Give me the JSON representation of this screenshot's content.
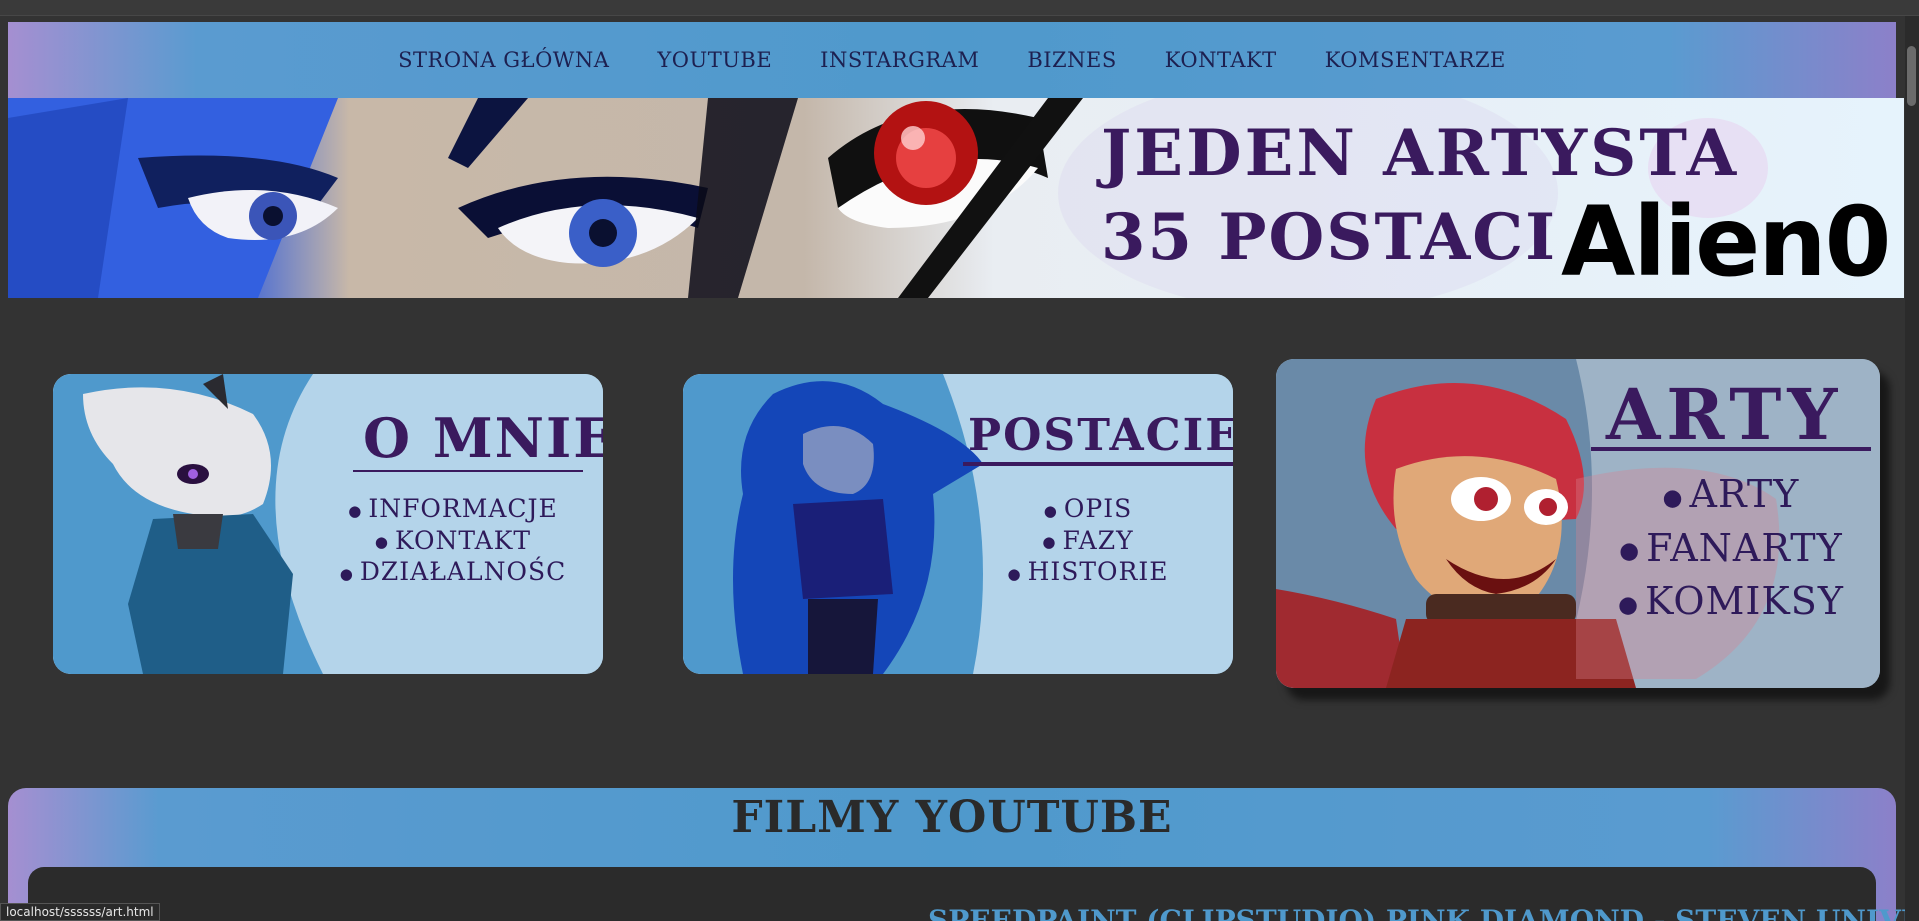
{
  "nav": {
    "items": [
      "STRONA GŁÓWNA",
      "YOUTUBE",
      "INSTARGRAM",
      "BIZNES",
      "KONTAKT",
      "KOMSENTARZE"
    ]
  },
  "banner": {
    "line1": "JEDEN ARTYSTA",
    "line2": "35 POSTACI",
    "signature": "Alien0"
  },
  "cards": {
    "about": {
      "title": "O MNIE",
      "items": [
        "INFORMACJE",
        "KONTAKT",
        "DZIAŁALNOŚC"
      ]
    },
    "characters": {
      "title": "POSTACIE",
      "items": [
        "OPIS",
        "FAZY",
        "HISTORIE"
      ]
    },
    "arts": {
      "title": "ARTY",
      "items": [
        "ARTY",
        "FANARTY",
        "KOMIKSY"
      ]
    }
  },
  "youtube": {
    "title": "FILMY YOUTUBE",
    "video_title": "SPEEDPAINT (CLIPSTUDIO) PINK DIAMOND - STEVEN UNIVERSE"
  },
  "status_bar": {
    "url": "localhost/ssssss/art.html"
  },
  "colors": {
    "page_bg": "#333333",
    "nav_bg": "#4f99cc",
    "title_text": "#3a1a5e",
    "card_bg": "#a8cce6"
  }
}
